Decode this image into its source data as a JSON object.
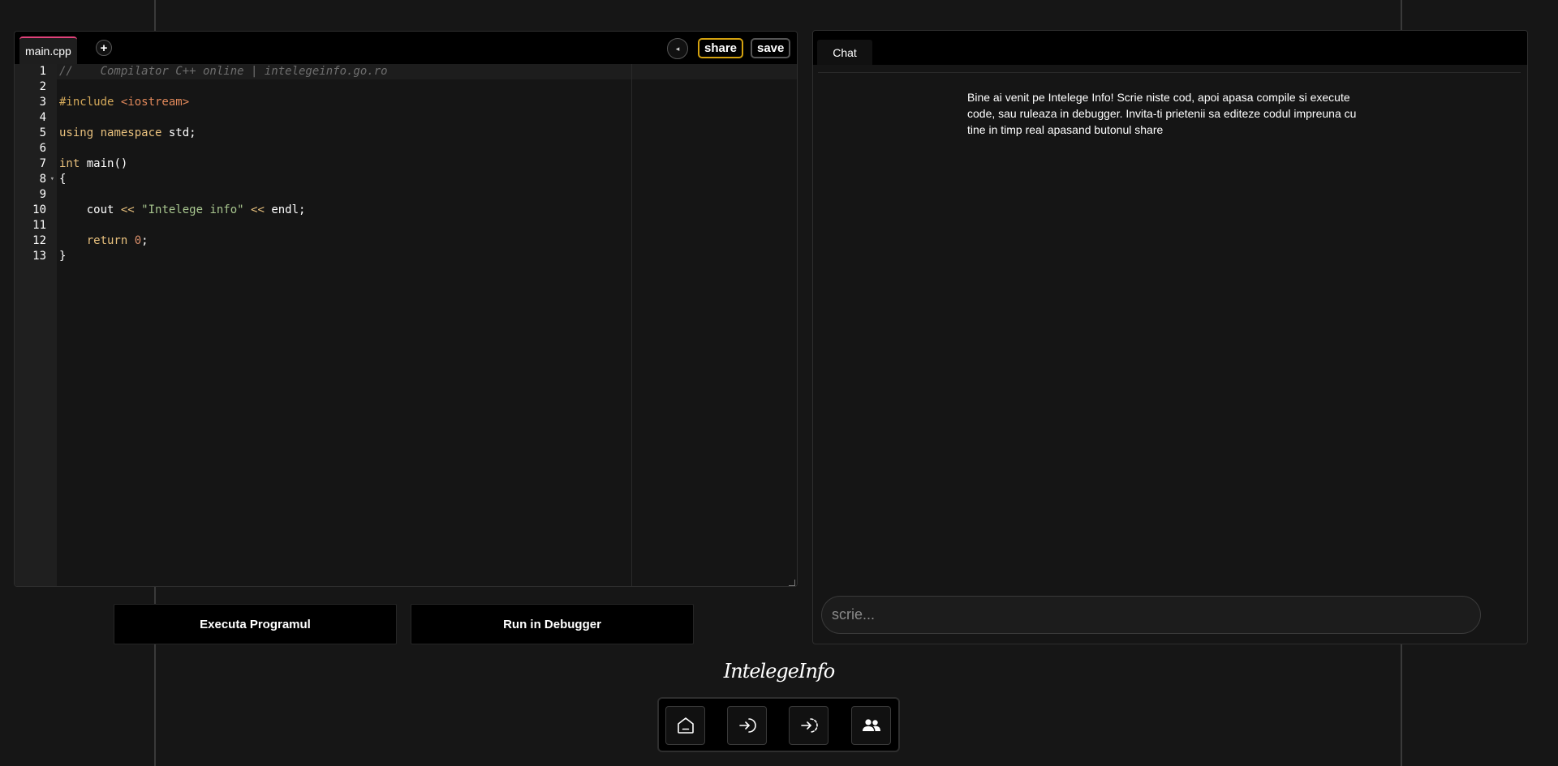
{
  "editor": {
    "file_tab": "main.cpp",
    "add_tab": "+",
    "collapse": "◂",
    "share_label": "share",
    "save_label": "save",
    "line_numbers": [
      "1",
      "2",
      "3",
      "4",
      "5",
      "6",
      "7",
      "8",
      "9",
      "10",
      "11",
      "12",
      "13"
    ],
    "code": [
      "//    Compilator C++ online | intelegeinfo.go.ro",
      "",
      "#include <iostream>",
      "",
      "using namespace std;",
      "",
      "int main()",
      "{",
      "",
      "    cout << \"Intelege info\" << endl;",
      "",
      "    return 0;",
      "}"
    ]
  },
  "actions": {
    "run_label": "Executa Programul",
    "debug_label": "Run in Debugger"
  },
  "chat": {
    "tab_label": "Chat",
    "welcome": "Bine ai venit pe Intelege Info! Scrie niste cod, apoi apasa compile si execute code, sau ruleaza in debugger. Invita-ti prietenii sa editeze codul impreuna cu tine in timp real apasand butonul share",
    "input_placeholder": "scrie...",
    "input_value": ""
  },
  "footer": {
    "brand": "IntelegeInfo",
    "nav": [
      {
        "icon": "home-icon"
      },
      {
        "icon": "login-icon"
      },
      {
        "icon": "register-icon"
      },
      {
        "icon": "users-icon"
      }
    ]
  },
  "colors": {
    "background": "#161616",
    "panel": "#000000",
    "share_border": "#d4a20f",
    "tab_accent": "#e0427a",
    "keyword": "#e8c07d",
    "include": "#e0885a",
    "string": "#a8c68f"
  }
}
